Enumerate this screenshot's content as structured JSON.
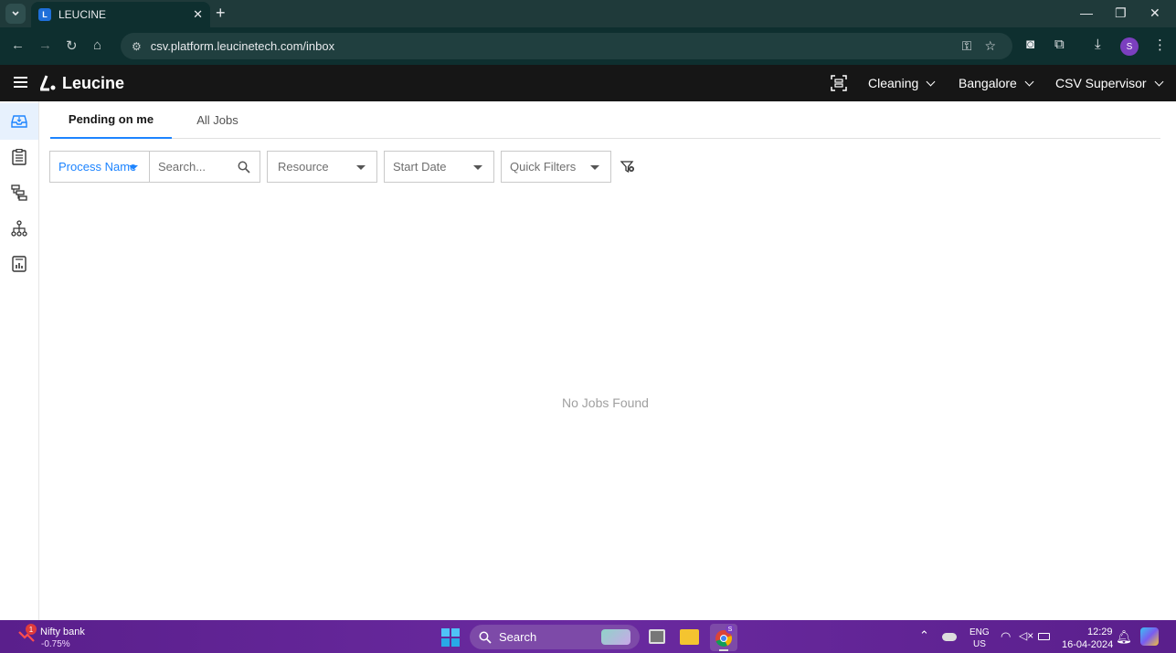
{
  "browser": {
    "tab_title": "LEUCINE",
    "tab_favicon": "L",
    "url": "csv.platform.leucinetech.com/inbox",
    "profile_initial": "S"
  },
  "header": {
    "brand": "Leucine",
    "facility_type": "Cleaning",
    "location": "Bangalore",
    "role": "CSV Supervisor"
  },
  "tabs": [
    {
      "label": "Pending on me",
      "active": true
    },
    {
      "label": "All Jobs",
      "active": false
    }
  ],
  "filters": {
    "process_name": "Process Name",
    "search_placeholder": "Search...",
    "resource": "Resource",
    "start_date": "Start Date",
    "quick_filters": "Quick Filters"
  },
  "empty_state": "No Jobs Found",
  "taskbar": {
    "notification_count": "1",
    "widget_title": "Nifty bank",
    "widget_value": "-0.75%",
    "search_label": "Search",
    "lang_line1": "ENG",
    "lang_line2": "US",
    "time": "12:29",
    "date": "16-04-2024",
    "chrome_badge": "S"
  },
  "colors": {
    "accent": "#1d84ff",
    "appbar": "#161616",
    "taskbar": "#5a1f8c"
  }
}
